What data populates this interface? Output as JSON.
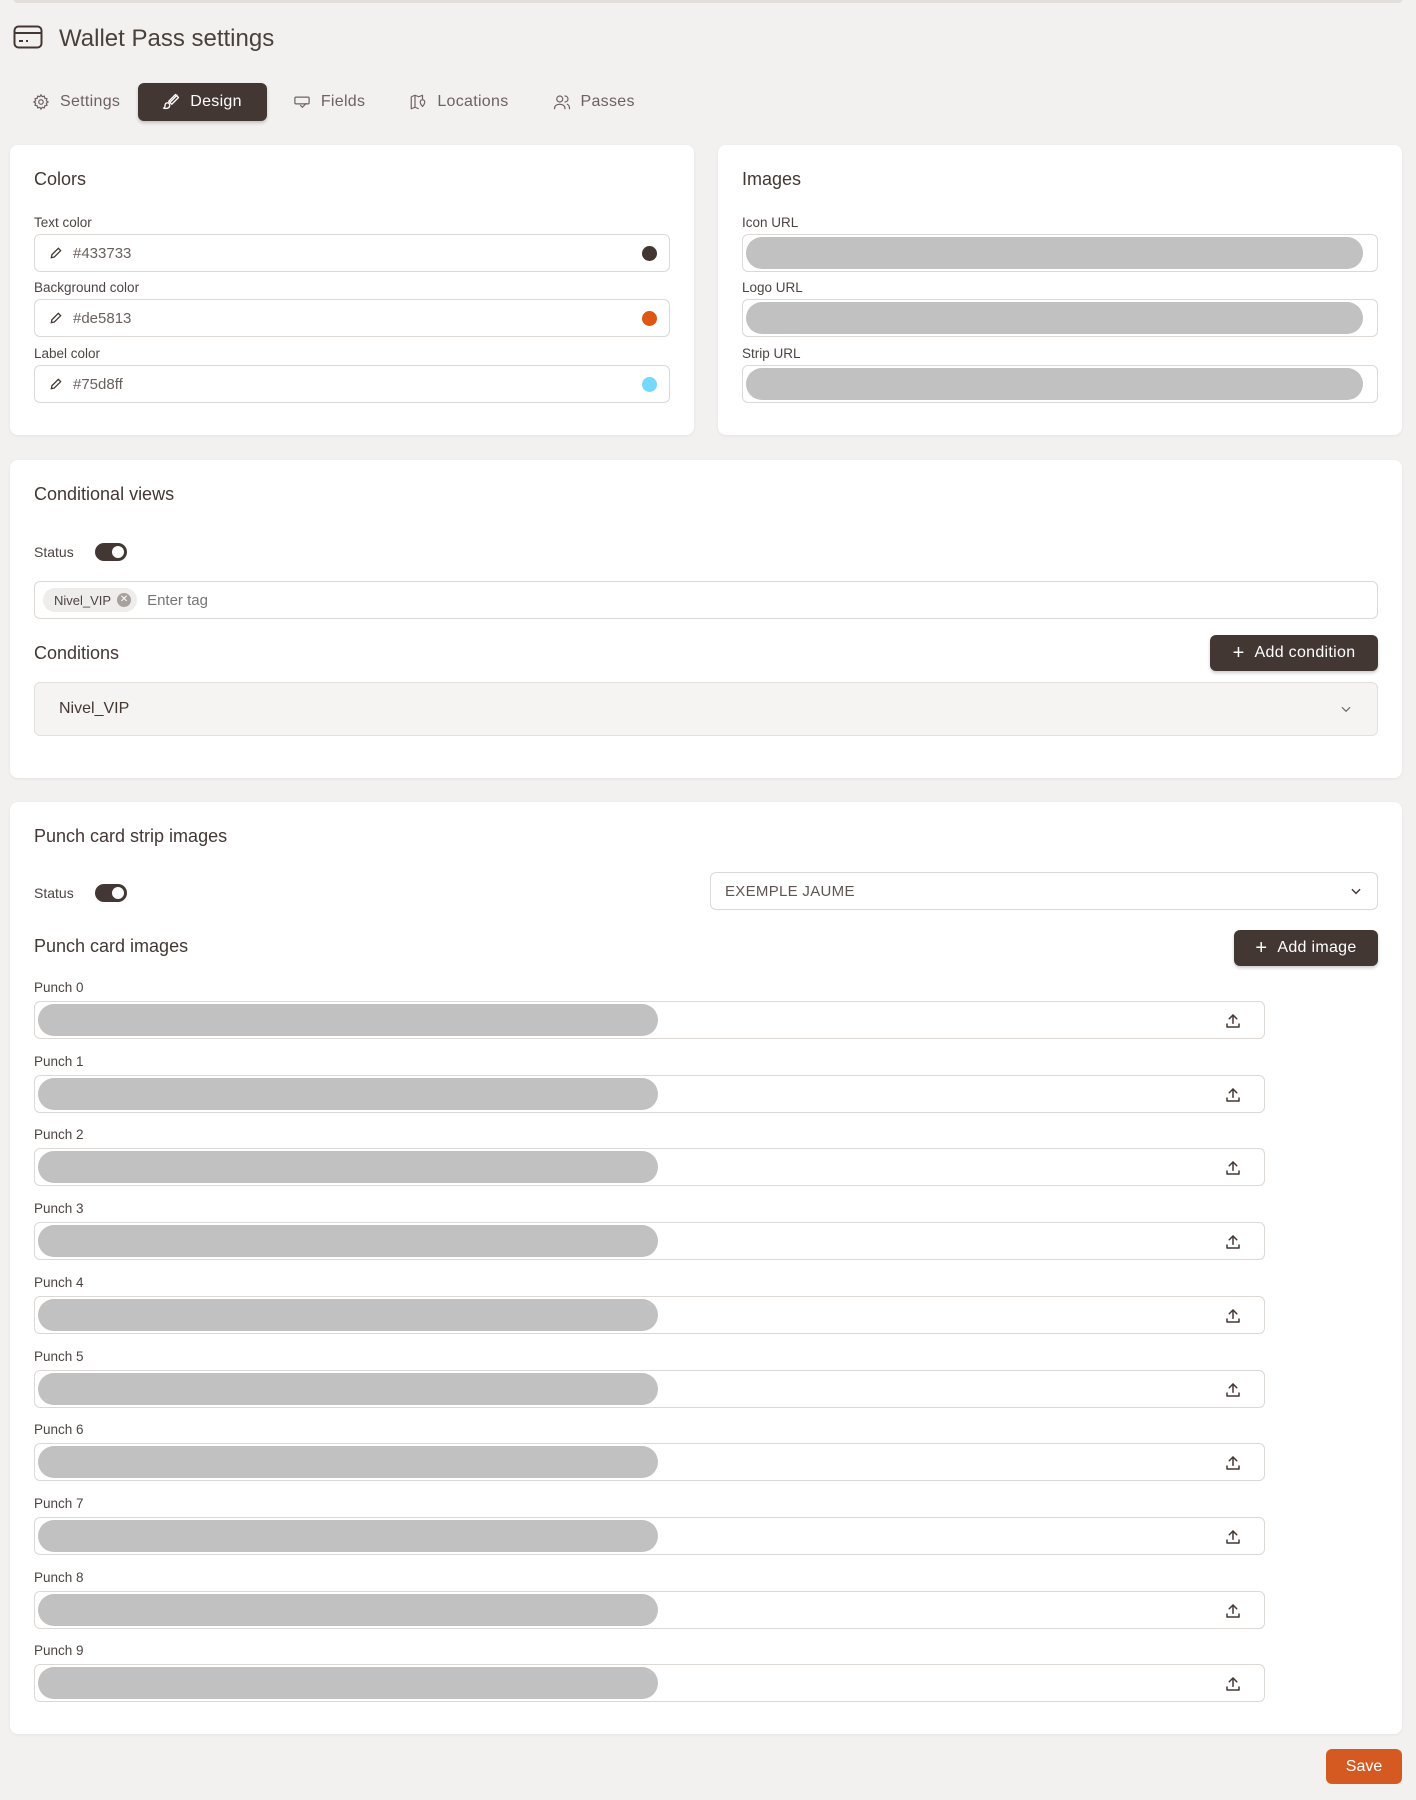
{
  "header": {
    "title": "Wallet Pass settings",
    "icon": "credit-card-icon"
  },
  "tabs": [
    {
      "label": "Settings",
      "icon": "gear-icon"
    },
    {
      "label": "Design",
      "icon": "brush-icon",
      "active": true
    },
    {
      "label": "Fields",
      "icon": "fields-icon"
    },
    {
      "label": "Locations",
      "icon": "map-icon"
    },
    {
      "label": "Passes",
      "icon": "users-icon"
    }
  ],
  "colors": {
    "title": "Colors",
    "text_color": {
      "label": "Text color",
      "value": "#433733"
    },
    "background_color": {
      "label": "Background color",
      "value": "#de5813"
    },
    "label_color": {
      "label": "Label color",
      "value": "#75d8ff"
    }
  },
  "images": {
    "title": "Images",
    "icon_url": {
      "label": "Icon URL"
    },
    "logo_url": {
      "label": "Logo URL"
    },
    "strip_url": {
      "label": "Strip URL"
    }
  },
  "conditional_views": {
    "title": "Conditional views",
    "status_label": "Status",
    "status_on": true,
    "tags": [
      "Nivel_VIP"
    ],
    "tag_placeholder": "Enter tag",
    "conditions_title": "Conditions",
    "add_condition_label": "Add condition",
    "conditions": [
      {
        "label": "Nivel_VIP"
      }
    ]
  },
  "punch_card": {
    "title": "Punch card strip images",
    "status_label": "Status",
    "status_on": true,
    "select_value": "EXEMPLE JAUME",
    "images_title": "Punch card images",
    "add_image_label": "Add image",
    "punches": [
      {
        "label": "Punch 0"
      },
      {
        "label": "Punch 1"
      },
      {
        "label": "Punch 2"
      },
      {
        "label": "Punch 3"
      },
      {
        "label": "Punch 4"
      },
      {
        "label": "Punch 5"
      },
      {
        "label": "Punch 6"
      },
      {
        "label": "Punch 7"
      },
      {
        "label": "Punch 8"
      },
      {
        "label": "Punch 9"
      }
    ]
  },
  "footer": {
    "save_label": "Save"
  },
  "theme": {
    "primary": "#433733",
    "accent": "#d45a22"
  }
}
